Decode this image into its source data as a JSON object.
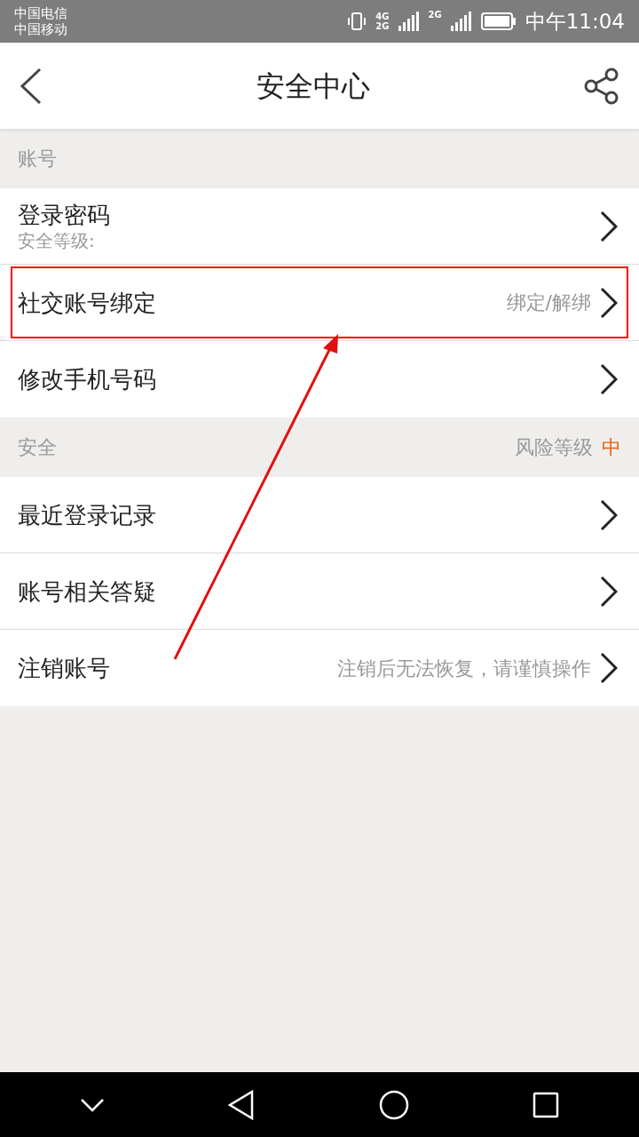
{
  "status_bar": {
    "carriers": [
      "中国电信",
      "中国移动"
    ],
    "network_labels": [
      "4G",
      "2G"
    ],
    "second_network_label": "2G",
    "time": "中午11:04"
  },
  "header": {
    "title": "安全中心"
  },
  "sections": [
    {
      "title": "账号",
      "rows": [
        {
          "title": "登录密码",
          "subtitle": "安全等级:",
          "highlighted": false
        },
        {
          "title": "社交账号绑定",
          "value": "绑定/解绑",
          "highlighted": true
        },
        {
          "title": "修改手机号码",
          "highlighted": false
        }
      ]
    },
    {
      "title": "安全",
      "right_label": "风险等级",
      "right_value": "中",
      "rows": [
        {
          "title": "最近登录记录",
          "highlighted": false
        },
        {
          "title": "账号相关答疑",
          "highlighted": false
        },
        {
          "title": "注销账号",
          "value": "注销后无法恢复，请谨慎操作",
          "highlighted": false
        }
      ]
    }
  ]
}
